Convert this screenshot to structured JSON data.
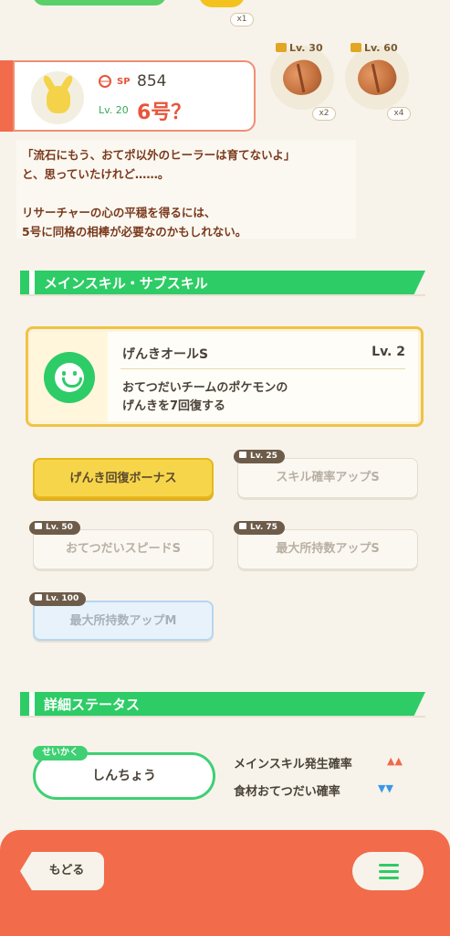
{
  "ingredients": [
    {
      "qty": "x1",
      "lock": ""
    },
    {
      "qty": "x2",
      "lock": "Lv. 30"
    },
    {
      "qty": "x4",
      "lock": "Lv. 60"
    }
  ],
  "profile": {
    "sp_label": "SP",
    "sp_value": "854",
    "level": "Lv. 20",
    "nickname": "6号？"
  },
  "story": {
    "line1": "「流石にもう、おてポ以外のヒーラーは育てないよ」",
    "line2": "と、思っていたけれど……。",
    "line3": "リサーチャーの心の平穏を得るには、",
    "line4": "5号に同格の相棒が必要なのかもしれない。"
  },
  "sections": {
    "skills": "メインスキル・サブスキル",
    "status": "詳細ステータス"
  },
  "main_skill": {
    "name": "げんきオールS",
    "level": "Lv. 2",
    "desc1": "おてつだいチームのポケモンの",
    "desc2": "げんきを7回復する"
  },
  "sub_skills": [
    {
      "label": "げんき回復ボーナス",
      "lock": ""
    },
    {
      "label": "スキル確率アップS",
      "lock": "Lv. 25"
    },
    {
      "label": "おてつだいスピードS",
      "lock": "Lv. 50"
    },
    {
      "label": "最大所持数アップS",
      "lock": "Lv. 75"
    },
    {
      "label": "最大所持数アップM",
      "lock": "Lv. 100"
    }
  ],
  "status": {
    "nature_tag": "せいかく",
    "nature": "しんちょう",
    "up_label": "メインスキル発生確率",
    "up_arrows": "▲▲",
    "down_label": "食材おてつだい確率",
    "down_arrows": "▼▼"
  },
  "nav": {
    "back": "もどる"
  },
  "colors": {
    "accent_green": "#2ecc66",
    "accent_red": "#f26b4b",
    "gold": "#f0c344"
  }
}
